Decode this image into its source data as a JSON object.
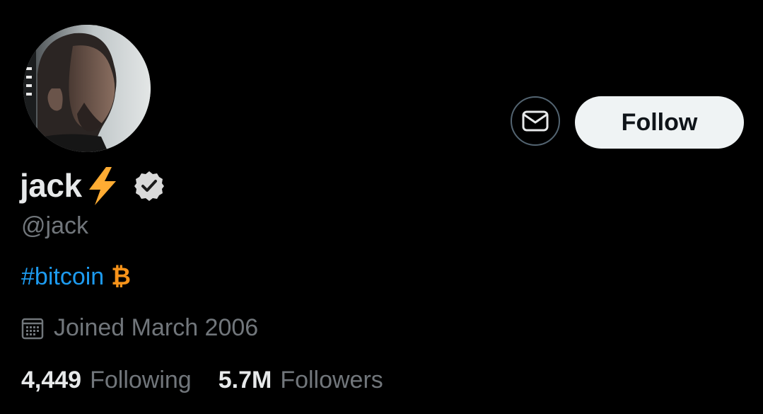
{
  "profile": {
    "display_name": "jack",
    "name_emoji": "lightning-bolt-emoji",
    "verified_badge": "verified-badge-gray",
    "handle": "@jack",
    "bio": {
      "hashtag": "#bitcoin",
      "symbol": "₿"
    },
    "joined": "Joined March 2006",
    "stats": {
      "following_count": "4,449",
      "following_label": "Following",
      "followers_count": "5.7M",
      "followers_label": "Followers"
    }
  },
  "actions": {
    "follow_label": "Follow",
    "message_icon": "envelope-icon"
  },
  "colors": {
    "background": "#000000",
    "primary_text": "#e7e9ea",
    "secondary_text": "#71767b",
    "link": "#1d9bf0",
    "bitcoin": "#f7931a",
    "bolt": "#ffac33",
    "follow_bg": "#eff3f4",
    "button_border": "#536471"
  }
}
